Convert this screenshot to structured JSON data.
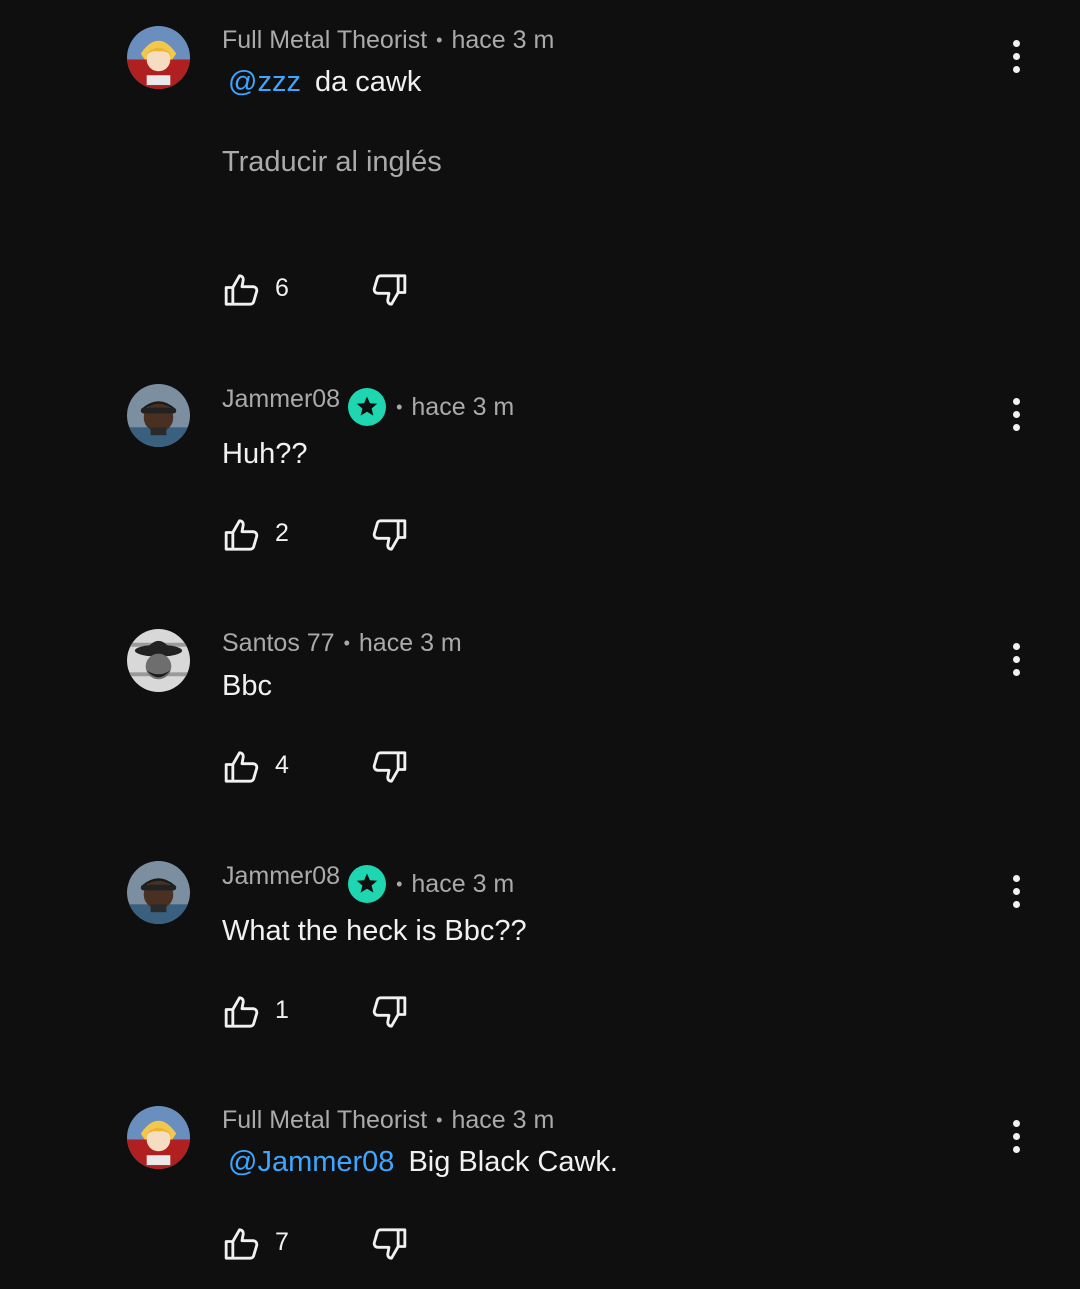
{
  "comments": [
    {
      "author": "Full Metal Theorist",
      "time": "hace 3 m",
      "mention": "@zzz",
      "text": "da cawk",
      "translate": "Traducir al inglés",
      "likes": "6",
      "avatar": "anime-boy-avatar"
    },
    {
      "author": "Jammer08",
      "time": "hace 3 m",
      "text": "Huh??",
      "likes": "2",
      "badge": "star-badge-icon",
      "avatar": "man-cap-avatar"
    },
    {
      "author": "Santos 77",
      "time": "hace 3 m",
      "text": "Bbc",
      "likes": "4",
      "avatar": "grayscale-hat-avatar"
    },
    {
      "author": "Jammer08",
      "time": "hace 3 m",
      "text": "What the heck is Bbc??",
      "likes": "1",
      "badge": "star-badge-icon",
      "avatar": "man-cap-avatar"
    },
    {
      "author": "Full Metal Theorist",
      "time": "hace 3 m",
      "mention": "@Jammer08",
      "text": "Big Black Cawk.",
      "likes": "7",
      "avatar": "anime-boy-avatar"
    }
  ],
  "colors": {
    "background": "#0f0f0f",
    "mention": "#3ea6ff",
    "badge": "#1ed6b0",
    "secondary_text": "#aaaaaa"
  }
}
